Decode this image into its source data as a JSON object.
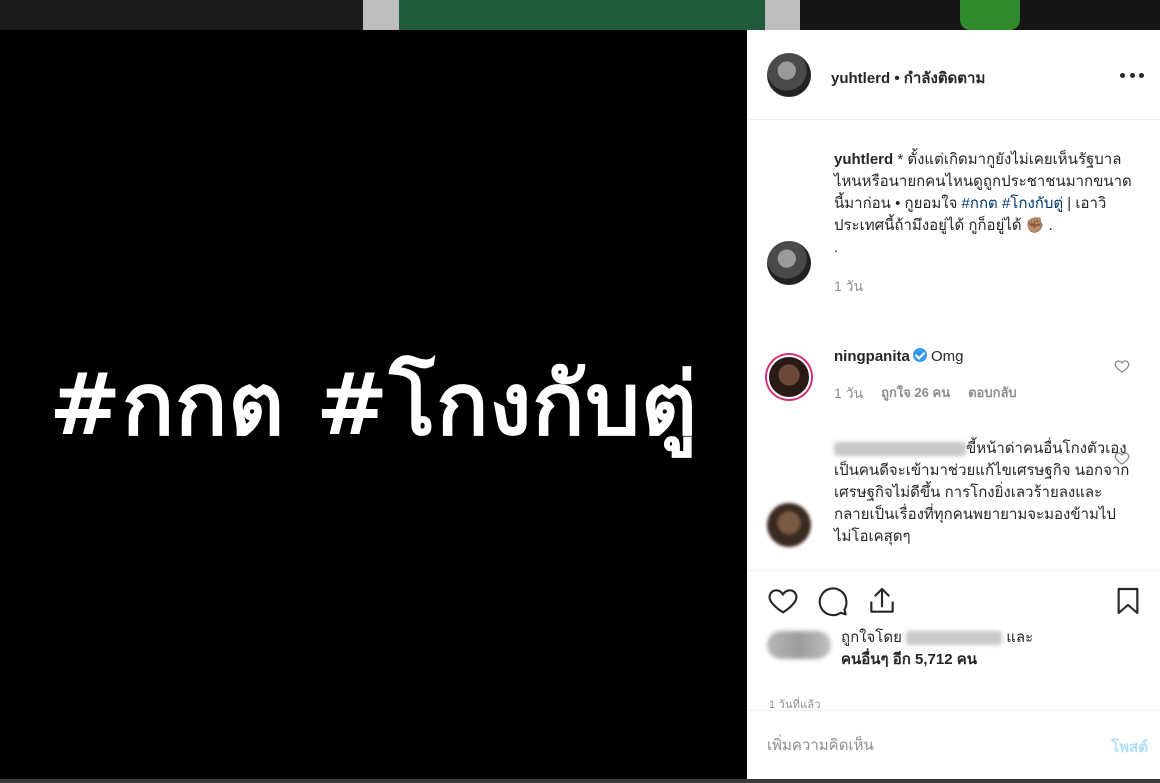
{
  "media": {
    "text": "#กกต #โกงกับตู่",
    "background": "#000000"
  },
  "header": {
    "username": "yuhtlerd",
    "separator": "•",
    "follow_status": "กำลังติดตาม",
    "more_icon": "more-horizontal-icon"
  },
  "caption": {
    "username": "yuhtlerd",
    "text_1": " * ตั้งแต่เกิดมากูยังไม่เคยเห็นรัฐบาลไหนหรือนายกคนไหนดูถูกประชาชนมากขนาดนี้มาก่อน • กูยอมใจ ",
    "hashtag_1": "#กกต",
    "hashtag_2": "#โกงกับตู่",
    "text_2": " | เอาวิ ประเทศนี้ถ้ามึงอยู่ได้ กูก็อยู่ได้ ✊🏽 .",
    "text_3": ".",
    "time": "1 วัน"
  },
  "comments": [
    {
      "username": "ningpanita",
      "verified": true,
      "text": "Omg",
      "time": "1 วัน",
      "likes": "ถูกใจ 26 คน",
      "reply": "ตอบกลับ"
    },
    {
      "username": "",
      "text": "ขี้หน้าด่าคนอื่นโกงตัวเองเป็นคนดีจะเข้ามาช่วยแก้ไขเศรษฐกิจ นอกจากเศรษฐกิจไม่ดีขึ้น การโกงยิ่งเลวร้ายลงและกลายเป็นเรื่องที่ทุกคนพยายามจะมองข้ามไป ไม่โอเคสุดๆ"
    }
  ],
  "actions": {
    "like_icon": "heart-icon",
    "comment_icon": "comment-icon",
    "share_icon": "share-icon",
    "save_icon": "bookmark-icon"
  },
  "likes": {
    "prefix": "ถูกใจโดย",
    "suffix": "และ",
    "others": "คนอื่นๆ อีก 5,712 คน"
  },
  "timestamp": "1 วันที่แล้ว",
  "add_comment": {
    "placeholder": "เพิ่มความคิดเห็น",
    "post_label": "โพสต์"
  }
}
